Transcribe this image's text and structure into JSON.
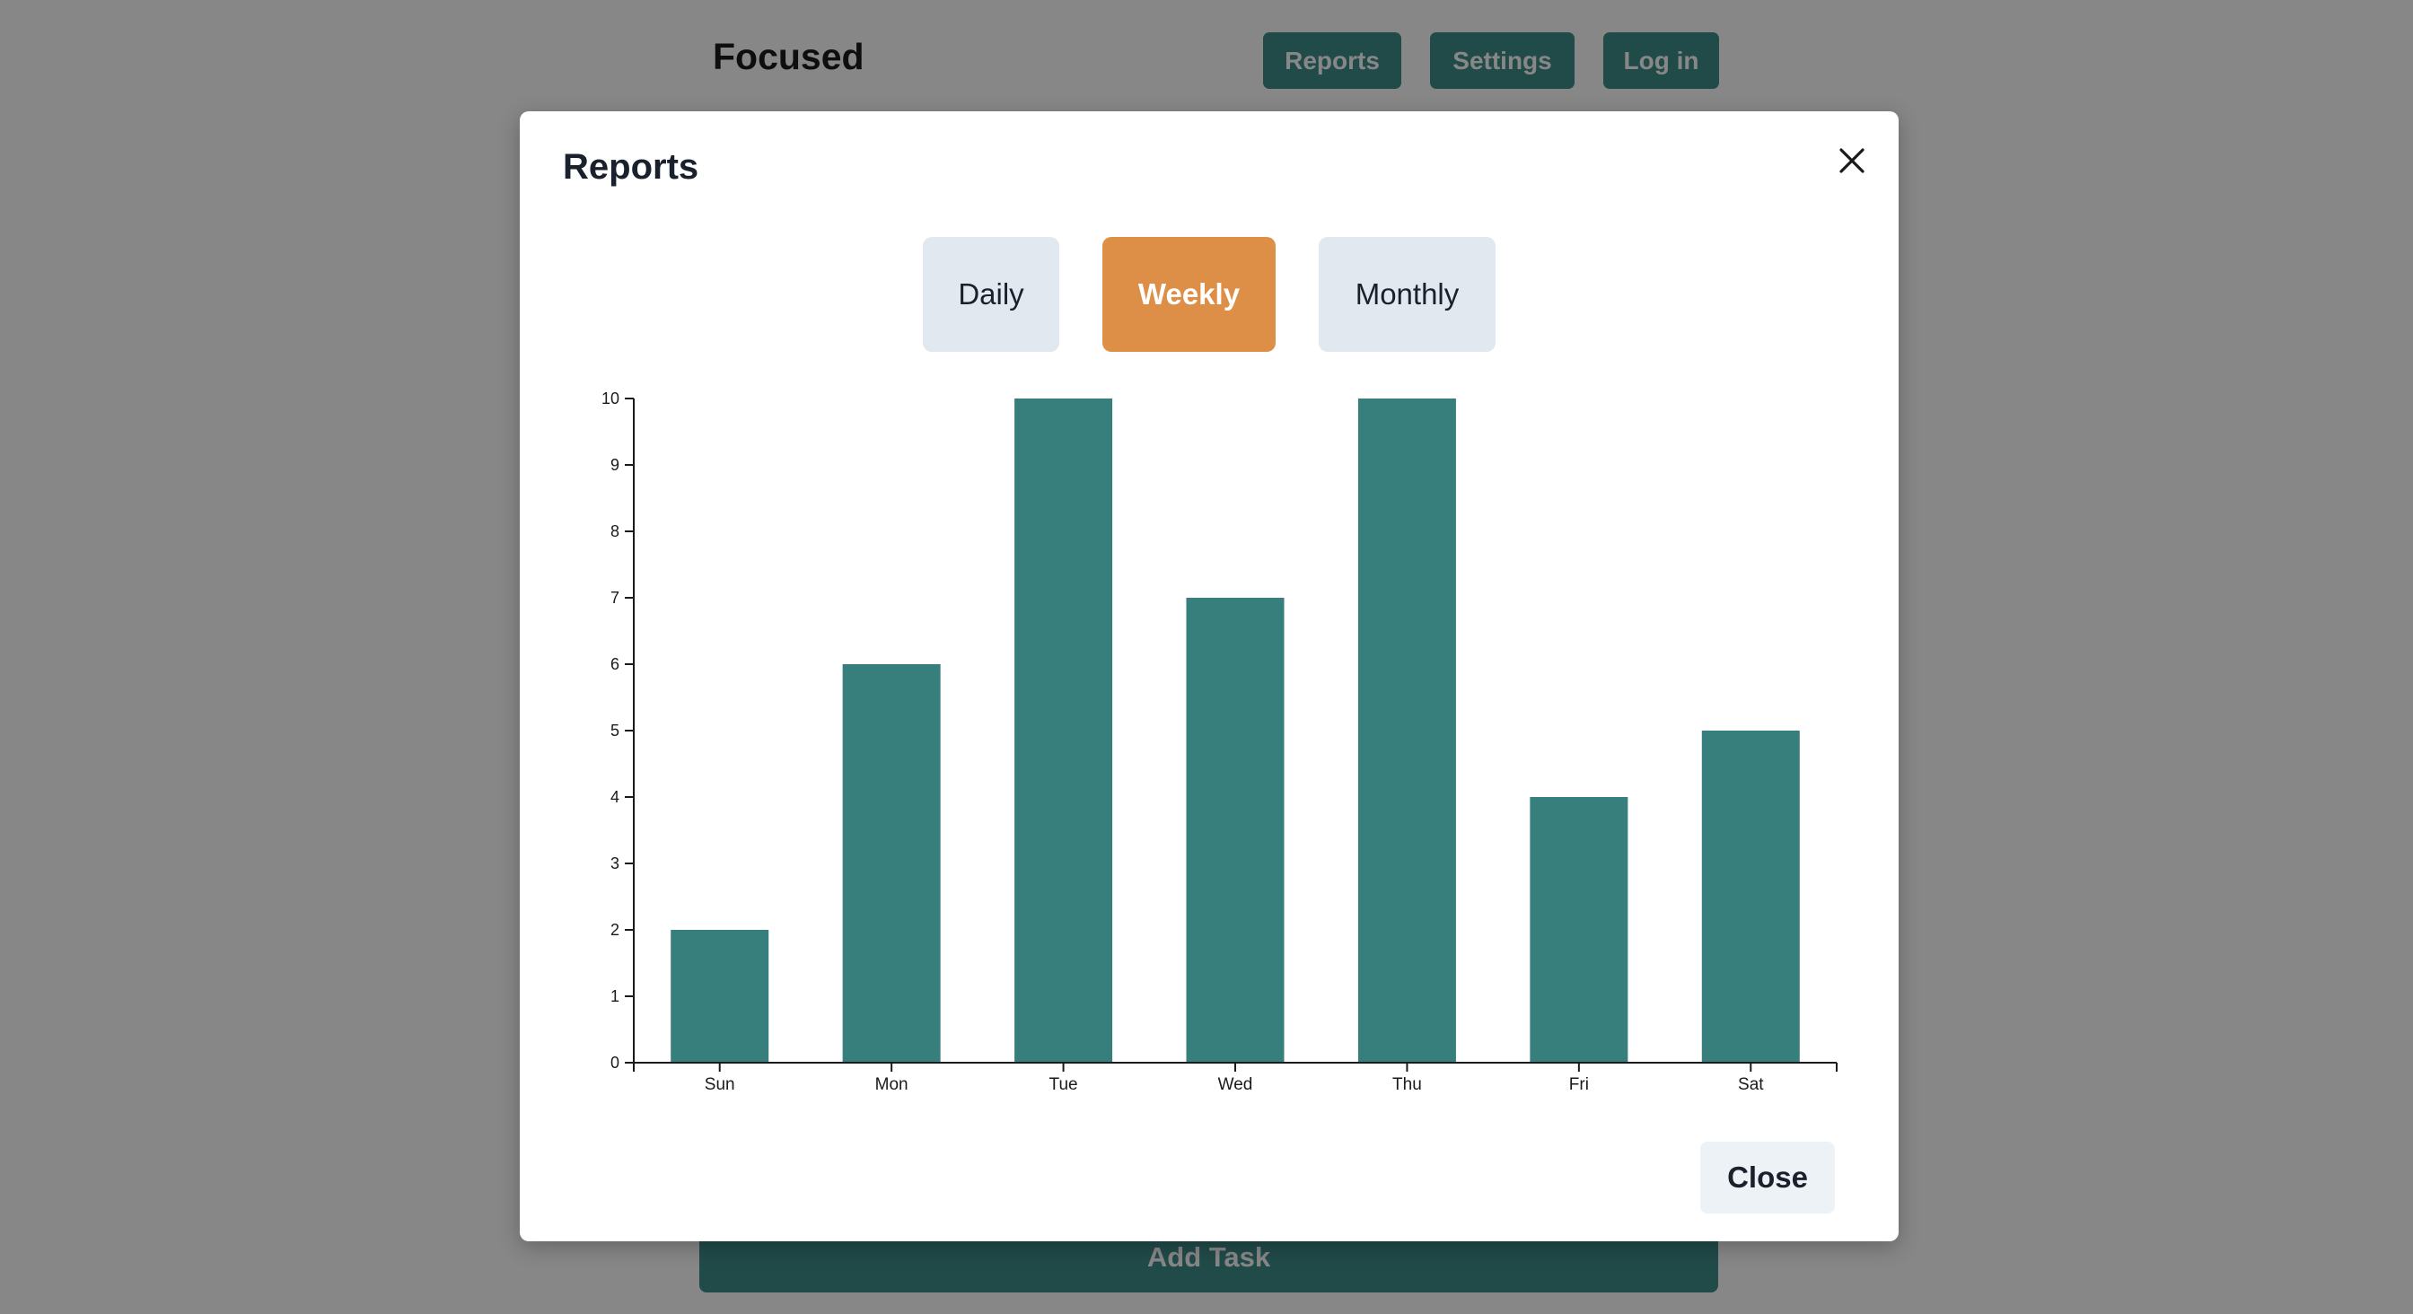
{
  "app": {
    "brand": "Focused",
    "nav": [
      "Reports",
      "Settings",
      "Log in"
    ],
    "add_task_label": "Add Task",
    "accent_color": "#3f8e8b"
  },
  "modal": {
    "title": "Reports",
    "close_icon": "close-icon",
    "close_label": "Close",
    "tabs": [
      {
        "label": "Daily",
        "active": false
      },
      {
        "label": "Weekly",
        "active": true
      },
      {
        "label": "Monthly",
        "active": false
      }
    ],
    "active_tab_color": "#dd8e47"
  },
  "chart_data": {
    "type": "bar",
    "categories": [
      "Sun",
      "Mon",
      "Tue",
      "Wed",
      "Thu",
      "Fri",
      "Sat"
    ],
    "values": [
      2,
      6,
      10,
      7,
      10,
      4,
      5
    ],
    "yticks": [
      "0",
      "1",
      "2",
      "3",
      "4",
      "5",
      "6",
      "7",
      "8",
      "9",
      "10"
    ],
    "ylim": [
      0,
      10
    ],
    "bar_color": "#377f7c",
    "grid": false,
    "title": "",
    "xlabel": "",
    "ylabel": ""
  }
}
